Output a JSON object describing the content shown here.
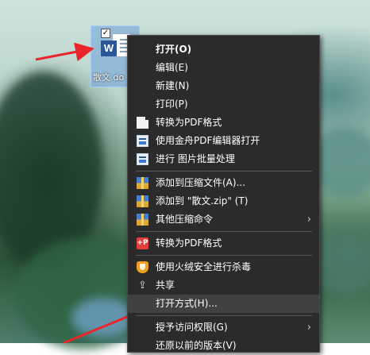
{
  "desktop": {
    "file": {
      "label": "散文.do"
    }
  },
  "context_menu": {
    "items": [
      {
        "label": "打开(O)",
        "icon": "",
        "bold": true
      },
      {
        "label": "编辑(E)",
        "icon": ""
      },
      {
        "label": "新建(N)",
        "icon": ""
      },
      {
        "label": "打印(P)",
        "icon": ""
      },
      {
        "label": "转换为PDF格式",
        "icon": "pdf-page-icon"
      },
      {
        "label": "使用金舟PDF编辑器打开",
        "icon": "pdf-editor-icon"
      },
      {
        "label": "进行 图片批量处理",
        "icon": "batch-image-icon"
      },
      {
        "label": "添加到压缩文件(A)...",
        "icon": "archive-icon"
      },
      {
        "label": "添加到 \"散文.zip\" (T)",
        "icon": "archive-icon"
      },
      {
        "label": "其他压缩命令",
        "icon": "archive-icon",
        "submenu": true
      },
      {
        "label": "转换为PDF格式",
        "icon": "pdf-convert-icon",
        "icon_text": "+P"
      },
      {
        "label": "使用火绒安全进行杀毒",
        "icon": "shield-icon"
      },
      {
        "label": "共享",
        "icon": "share-icon",
        "icon_text": "⇪"
      },
      {
        "label": "打开方式(H)...",
        "icon": "",
        "highlighted": true
      },
      {
        "label": "授予访问权限(G)",
        "icon": "",
        "submenu": true
      },
      {
        "label": "还原以前的版本(V)",
        "icon": ""
      }
    ],
    "submenu_glyph": "›"
  },
  "colors": {
    "menu_bg": "#2b2b2b",
    "menu_highlight": "#414141",
    "arrow": "#e8262b"
  }
}
